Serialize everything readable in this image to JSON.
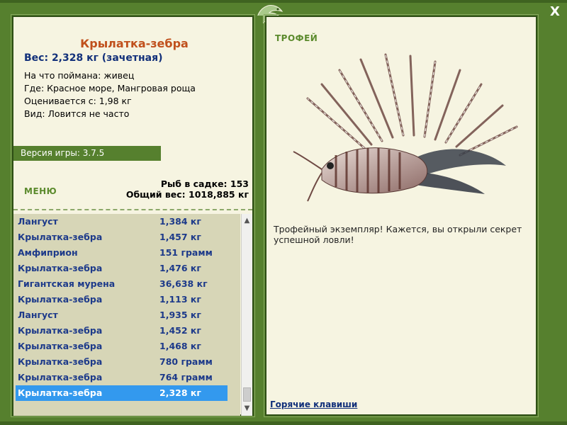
{
  "window": {
    "close_label": "X"
  },
  "fish": {
    "title": "Крылатка-зебра",
    "weight": "Вес: 2,328 кг (зачетная)",
    "caught_on": "На что поймана: живец",
    "where": "Где: Красное море, Мангровая роща",
    "valued_from": "Оценивается с: 1,98 кг",
    "kind": "Вид: Ловится не часто"
  },
  "version": "Версия игры: 3.7.5",
  "menu_label": "МЕНЮ",
  "stats": {
    "fish_in_cage": "Рыб в садке: 153",
    "total_weight": "Общий вес: 1018,885 кг"
  },
  "catch_list": [
    {
      "name": "Лангуст",
      "weight": "1,384 кг"
    },
    {
      "name": "Крылатка-зебра",
      "weight": "1,457 кг"
    },
    {
      "name": "Амфиприон",
      "weight": "151 грамм"
    },
    {
      "name": "Крылатка-зебра",
      "weight": "1,476 кг"
    },
    {
      "name": "Гигантская мурена",
      "weight": "36,638 кг"
    },
    {
      "name": "Крылатка-зебра",
      "weight": "1,113 кг"
    },
    {
      "name": "Лангуст",
      "weight": "1,935 кг"
    },
    {
      "name": "Крылатка-зебра",
      "weight": "1,452 кг"
    },
    {
      "name": "Крылатка-зебра",
      "weight": "1,468 кг"
    },
    {
      "name": "Крылатка-зебра",
      "weight": "780 грамм"
    },
    {
      "name": "Крылатка-зебра",
      "weight": "764 грамм"
    },
    {
      "name": "Крылатка-зебра",
      "weight": "2,328 кг"
    }
  ],
  "selected_index": 11,
  "trophy": {
    "label": "ТРОФЕЙ",
    "text": "Трофейный экземпляр! Кажется, вы открыли секрет успешной ловли!"
  },
  "hotkeys_label": "Горячие клавиши",
  "icons": {
    "close": "close-icon",
    "logo": "fish-logo-icon",
    "scroll_up": "chevron-up-icon",
    "scroll_down": "chevron-down-icon"
  },
  "colors": {
    "frame": "#56802e",
    "panel": "#f6f4e1",
    "title": "#c0501c",
    "text_blue": "#12307a",
    "selection": "#3399ee",
    "list_bg": "#d7d6b7"
  }
}
